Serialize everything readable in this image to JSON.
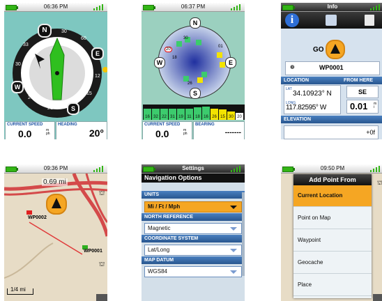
{
  "screen1": {
    "time": "06:36 PM",
    "compass": {
      "n": "N",
      "e": "E",
      "s": "S",
      "w": "W",
      "marks": [
        "30",
        "60",
        "12",
        "15",
        "21",
        "24",
        "30",
        "33"
      ]
    },
    "speed_label": "CURRENT SPEED",
    "speed_value": "0.0",
    "speed_unit": "mph",
    "heading_label": "HEADING",
    "heading_value": "20°"
  },
  "screen2": {
    "time": "06:37 PM",
    "compass": {
      "n": "N",
      "e": "E",
      "s": "S",
      "w": "W"
    },
    "sat_labels": [
      "20",
      "18",
      "30",
      "01",
      "26",
      "15",
      "08",
      "17",
      "33",
      "11",
      "12",
      "22"
    ],
    "bar_numbers": [
      "16",
      "32",
      "22",
      "31",
      "19",
      "11",
      "18",
      "16",
      "26",
      "15",
      "30",
      "20"
    ],
    "speed_label": "CURRENT SPEED",
    "speed_value": "0.0",
    "speed_unit": "mph",
    "bearing_label": "BEARING",
    "bearing_value": "-------"
  },
  "screen3": {
    "title": "Info",
    "go_label": "GO",
    "waypoint": "WP0001",
    "location_label": "LOCATION",
    "from_here_label": "FROM HERE",
    "lat_label": "LAT",
    "lat_value": "34.10923° N",
    "long_label": "LONG",
    "long_value": "117.82595° W",
    "direction": "SE",
    "distance": "0.01",
    "distance_unit": "mi",
    "elevation_label": "ELEVATION",
    "elevation_value": "+0f"
  },
  "screen4": {
    "time": "09:36 PM",
    "distance": "0.69 mi",
    "wp2": "WP0002",
    "wp1": "WP0001",
    "scale": "1/4 mi"
  },
  "screen5": {
    "title": "Settings",
    "header": "Navigation Options",
    "units_label": "UNITS",
    "units_value": "Mi / Ft / Mph",
    "north_label": "NORTH REFERENCE",
    "north_value": "Magnetic",
    "coord_label": "COORDINATE SYSTEM",
    "coord_value": "Lat/Long",
    "datum_label": "MAP DATUM",
    "datum_value": "WGS84"
  },
  "screen6": {
    "time": "09:50 PM",
    "title": "Add Point From",
    "items": [
      "Current Location",
      "Point on Map",
      "Waypoint",
      "Geocache",
      "Place"
    ]
  },
  "colors": {
    "accent": "#f5a623",
    "green": "#33b516",
    "blue": "#28568f"
  }
}
